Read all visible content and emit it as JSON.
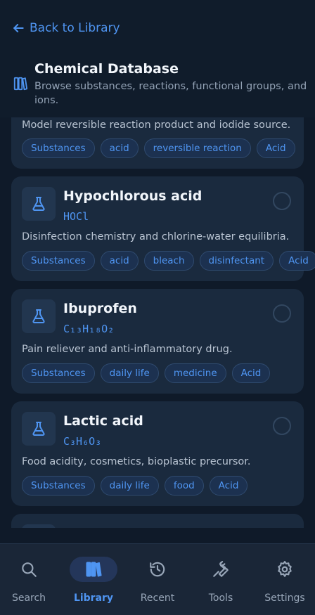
{
  "nav": {
    "back_label": "Back to Library"
  },
  "header": {
    "title": "Chemical Database",
    "subtitle": "Browse substances, reactions, functional groups, and ions."
  },
  "cards": [
    {
      "name": "",
      "formula": "",
      "description": "Model reversible reaction product and iodide source.",
      "tags": [
        "Substances",
        "acid",
        "reversible reaction",
        "Acid"
      ]
    },
    {
      "name": "Hypochlorous acid",
      "formula": "HOCl",
      "description": "Disinfection chemistry and chlorine-water equilibria.",
      "tags": [
        "Substances",
        "acid",
        "bleach",
        "disinfectant",
        "Acid"
      ]
    },
    {
      "name": "Ibuprofen",
      "formula": "C₁₃H₁₈O₂",
      "description": "Pain reliever and anti-inflammatory drug.",
      "tags": [
        "Substances",
        "daily life",
        "medicine",
        "Acid"
      ]
    },
    {
      "name": "Lactic acid",
      "formula": "C₃H₆O₃",
      "description": "Food acidity, cosmetics, bioplastic precursor.",
      "tags": [
        "Substances",
        "daily life",
        "food",
        "Acid"
      ]
    }
  ],
  "bottom_nav": {
    "items": [
      {
        "label": "Search",
        "icon": "search-icon"
      },
      {
        "label": "Library",
        "icon": "library-icon",
        "active": true
      },
      {
        "label": "Recent",
        "icon": "history-icon"
      },
      {
        "label": "Tools",
        "icon": "wrench-icon"
      },
      {
        "label": "Settings",
        "icon": "gear-icon"
      }
    ]
  },
  "colors": {
    "accent": "#4f95f2",
    "background": "#0f1a29",
    "card": "#1a2a3e"
  }
}
